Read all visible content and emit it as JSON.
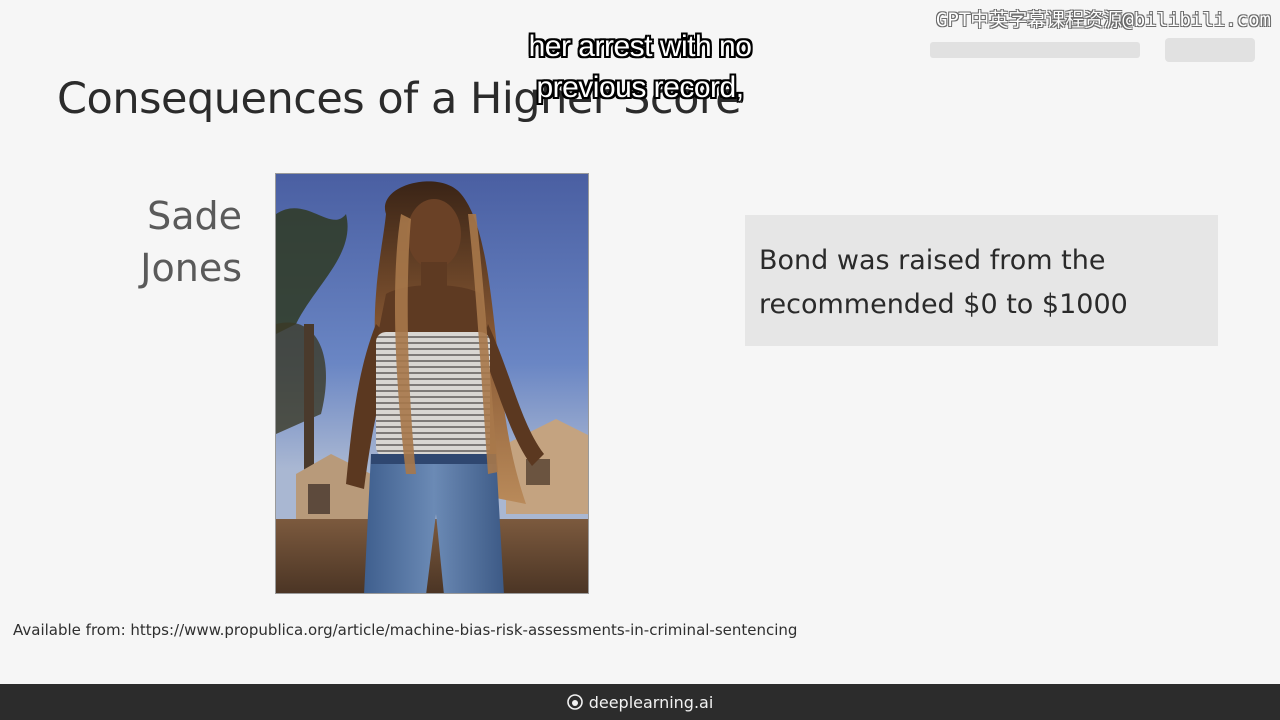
{
  "slide": {
    "title": "Consequences of a Higher Score",
    "person_name_line1": "Sade",
    "person_name_line2": "Jones",
    "callout_line1": "Bond was raised from the",
    "callout_line2": "recommended $0 to $1000",
    "source": "Available from: https://www.propublica.org/article/machine-bias-risk-assessments-in-criminal-sentencing"
  },
  "subtitle": {
    "line1": "her arrest with no",
    "line2": "previous record,"
  },
  "watermark": {
    "text": "GPT中英字幕课程资源@bilibili.com"
  },
  "footer": {
    "brand": "deeplearning.ai",
    "logo_icon": "deeplearning-logo-icon"
  },
  "colors": {
    "background": "#f6f6f6",
    "callout_bg": "#e6e6e6",
    "footer_bg": "#2c2c2c"
  }
}
